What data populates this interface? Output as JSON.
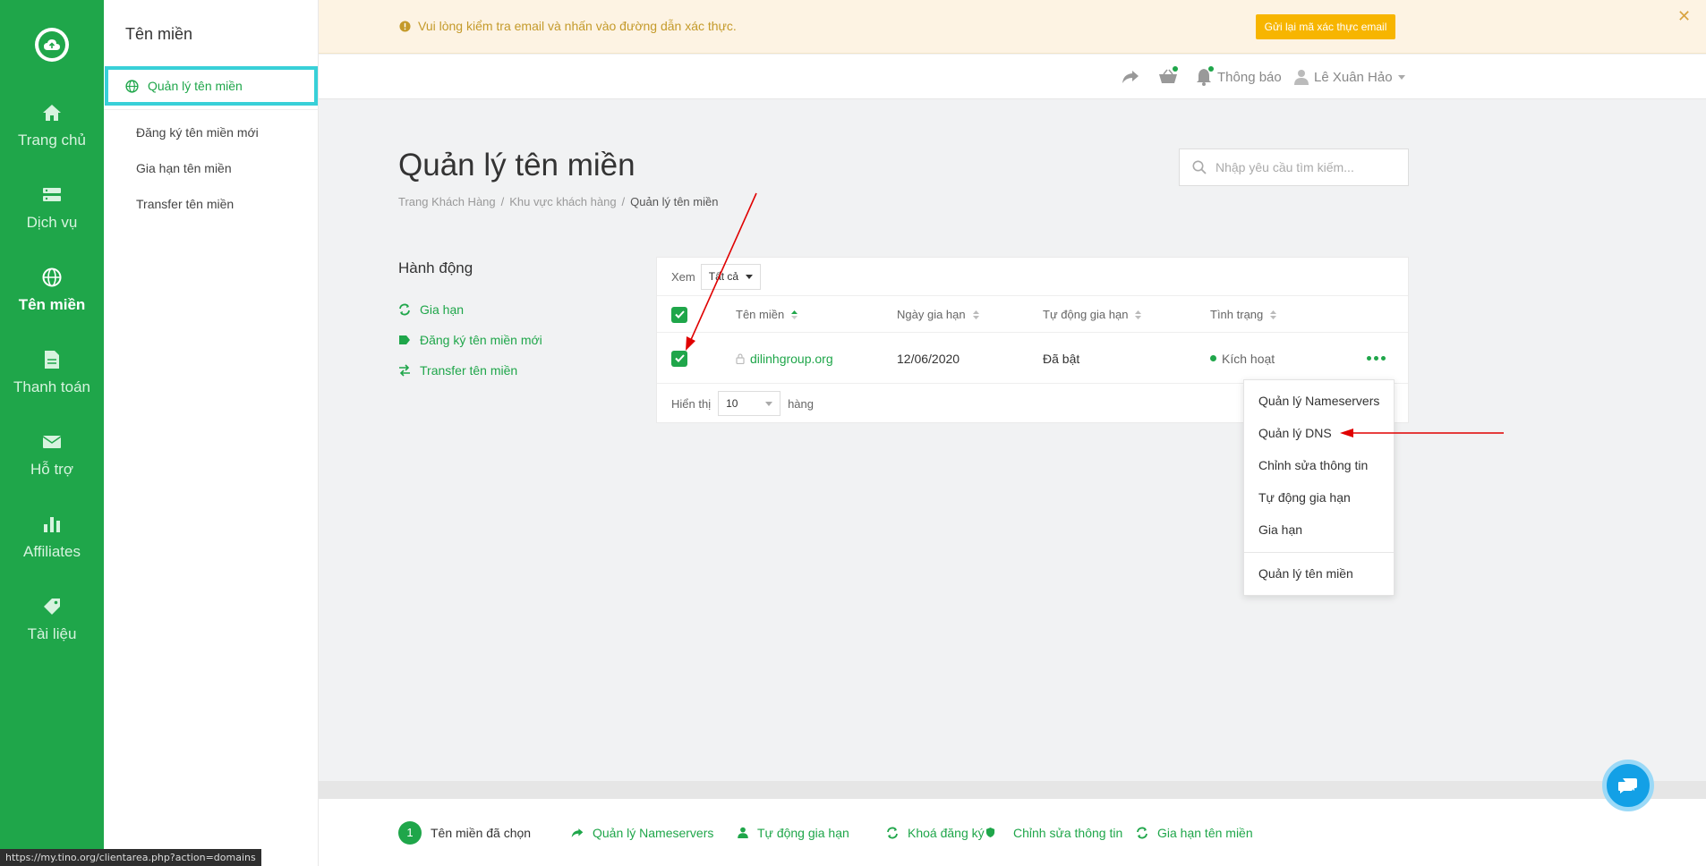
{
  "nav": {
    "items": [
      {
        "label": "Trang chủ",
        "icon": "home-icon"
      },
      {
        "label": "Dịch vụ",
        "icon": "server-icon"
      },
      {
        "label": "Tên miền",
        "icon": "globe-icon",
        "active": true
      },
      {
        "label": "Thanh toán",
        "icon": "document-icon"
      },
      {
        "label": "Hỗ trợ",
        "icon": "envelope-icon"
      },
      {
        "label": "Affiliates",
        "icon": "bar-chart-icon"
      },
      {
        "label": "Tài liệu",
        "icon": "tag-icon"
      }
    ]
  },
  "subnav": {
    "title": "Tên miền",
    "active_label": "Quản lý tên miền",
    "links": [
      "Đăng ký tên miền mới",
      "Gia hạn tên miền",
      "Transfer tên miền"
    ]
  },
  "banner": {
    "message": "Vui lòng kiểm tra email và nhấn vào đường dẫn xác thực.",
    "button": "Gửi lại mã xác thực email",
    "close": "✕"
  },
  "topbar": {
    "notifications": "Thông báo",
    "user": "Lê Xuân Hảo"
  },
  "page": {
    "title": "Quản lý tên miền",
    "breadcrumb": [
      "Trang Khách Hàng",
      "Khu vực khách hàng",
      "Quản lý tên miền"
    ],
    "search_placeholder": "Nhập yêu cầu tìm kiếm..."
  },
  "actions": {
    "title": "Hành động",
    "items": [
      "Gia hạn",
      "Đăng ký tên miền mới",
      "Transfer tên miền"
    ]
  },
  "table": {
    "filter_label": "Xem",
    "filter_value": "Tất cả",
    "headers": [
      "Tên miền",
      "Ngày gia hạn",
      "Tự động gia hạn",
      "Tình trạng"
    ],
    "rows": [
      {
        "domain": "dilinhgroup.org",
        "renew_date": "12/06/2020",
        "auto_renew": "Đã bật",
        "status": "Kích hoạt"
      }
    ],
    "show_label": "Hiển thị",
    "rows_per_page": "10",
    "rows_suffix": "hàng"
  },
  "menu": {
    "items": [
      "Quản lý Nameservers",
      "Quản lý DNS",
      "Chỉnh sửa thông tin",
      "Tự động gia hạn",
      "Gia hạn"
    ],
    "footer_item": "Quản lý tên miền"
  },
  "bottombar": {
    "count": "1",
    "selected_label": "Tên miền đã chọn",
    "actions": [
      "Quản lý Nameservers",
      "Tự động gia hạn",
      "Khoá đăng ký",
      "Chỉnh sửa thông tin",
      "Gia hạn tên miền"
    ]
  },
  "status_url": "https://my.tino.org/clientarea.php?action=domains",
  "colors": {
    "brand_green": "#1fa64a",
    "highlight_cyan": "#38d0d8",
    "annotation_red": "#e00000",
    "banner_bg": "#fdf3e3",
    "warning_yellow": "#f7b500"
  }
}
